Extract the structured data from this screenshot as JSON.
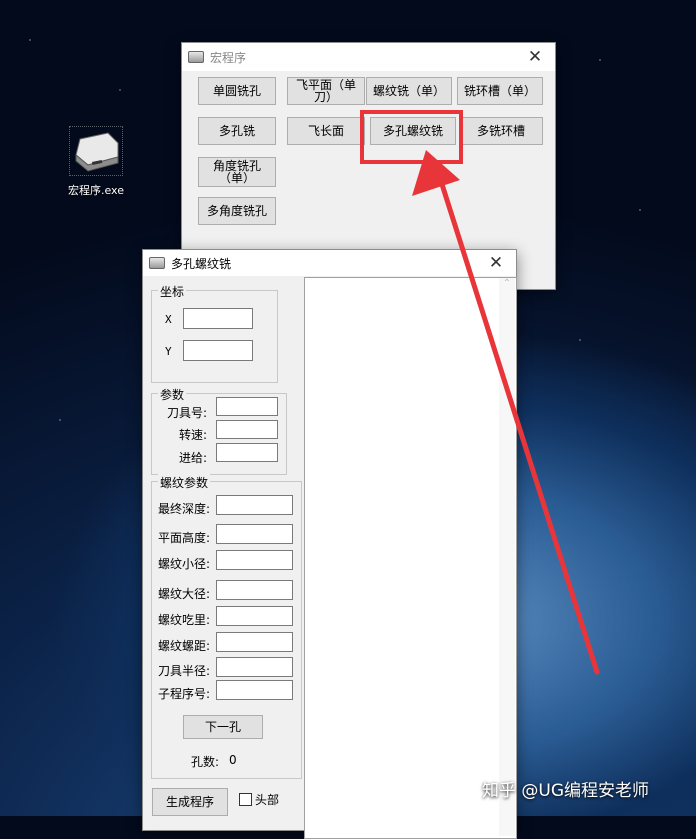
{
  "desktop": {
    "icon_name": "drive-icon",
    "icon_label": "宏程序.exe"
  },
  "main_window": {
    "title": "宏程序",
    "buttons": [
      "单圆铣孔",
      "飞平面（单刀）",
      "螺纹铣（单）",
      "铣环槽（单）",
      "多孔铣",
      "飞长面",
      "多孔螺纹铣",
      "多铣环槽",
      "角度铣孔（单）",
      "多角度铣孔"
    ]
  },
  "sub_window": {
    "title": "多孔螺纹铣",
    "coord_group": {
      "caption": "坐标",
      "x_label": "X",
      "y_label": "Y",
      "x_value": "",
      "y_value": ""
    },
    "param_group": {
      "caption": "参数",
      "fields": [
        {
          "label": "刀具号:",
          "value": ""
        },
        {
          "label": "转速:",
          "value": ""
        },
        {
          "label": "进给:",
          "value": ""
        }
      ]
    },
    "thread_group": {
      "caption": "螺纹参数",
      "fields": [
        {
          "label": "最终深度:",
          "value": ""
        },
        {
          "label": "平面高度:",
          "value": ""
        },
        {
          "label": "螺纹小径:",
          "value": ""
        },
        {
          "label": "螺纹大径:",
          "value": ""
        },
        {
          "label": "螺纹吃里:",
          "value": ""
        },
        {
          "label": "螺纹螺距:",
          "value": ""
        },
        {
          "label": "刀具半径:",
          "value": ""
        },
        {
          "label": "子程序号:",
          "value": ""
        }
      ]
    },
    "next_button": "下一孔",
    "hole_count_label": "孔数:",
    "hole_count_value": "0",
    "generate_button": "生成程序",
    "header_checkbox_label": "头部"
  },
  "annotation": {
    "highlight_color": "#e8353a"
  },
  "watermark": "知乎 @UG编程安老师"
}
